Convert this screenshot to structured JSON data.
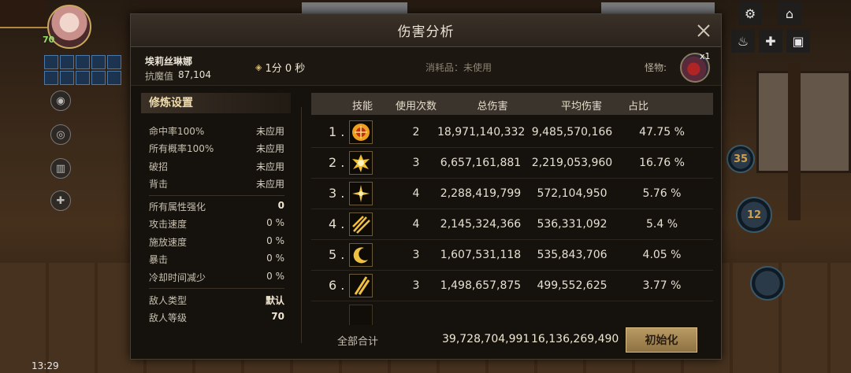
{
  "dialog": {
    "title": "伤害分析",
    "close_icon": "close-icon"
  },
  "info": {
    "character_name": "埃莉丝琳娜",
    "resist_label": "抗魔值",
    "resist_value": "87,104",
    "time": "1分 0 秒",
    "consumable_label": "消耗品：",
    "consumable_value": "未使用",
    "monster_label": "怪物:",
    "monster_count": "x1"
  },
  "settings": {
    "header": "修炼设置",
    "rows": [
      {
        "key": "命中率100%",
        "value": "未应用"
      },
      {
        "key": "所有概率100%",
        "value": "未应用"
      },
      {
        "key": "破招",
        "value": "未应用"
      },
      {
        "key": "背击",
        "value": "未应用"
      },
      {
        "key": "所有属性强化",
        "value": "0"
      },
      {
        "key": "攻击速度",
        "value": "0 %"
      },
      {
        "key": "施放速度",
        "value": "0 %"
      },
      {
        "key": "暴击",
        "value": "0 %"
      },
      {
        "key": "冷却时间减少",
        "value": "0 %"
      },
      {
        "key": "敌人类型",
        "value": "默认"
      },
      {
        "key": "敌人等级",
        "value": "70"
      }
    ]
  },
  "table": {
    "headers": {
      "skill": "技能",
      "uses": "使用次数",
      "total": "总伤害",
      "avg": "平均伤害",
      "share": "占比"
    },
    "rows": [
      {
        "rank": "1 .",
        "icon": "fire-burst-icon",
        "uses": "2",
        "total": "18,971,140,332",
        "avg": "9,485,570,166",
        "share": "47.75 %"
      },
      {
        "rank": "2 .",
        "icon": "explosion-icon",
        "uses": "3",
        "total": "6,657,161,881",
        "avg": "2,219,053,960",
        "share": "16.76 %"
      },
      {
        "rank": "3 .",
        "icon": "spark-cross-icon",
        "uses": "4",
        "total": "2,288,419,799",
        "avg": "572,104,950",
        "share": "5.76 %"
      },
      {
        "rank": "4 .",
        "icon": "claw-strike-icon",
        "uses": "4",
        "total": "2,145,324,366",
        "avg": "536,331,092",
        "share": "5.4 %"
      },
      {
        "rank": "5 .",
        "icon": "crescent-icon",
        "uses": "3",
        "total": "1,607,531,118",
        "avg": "535,843,706",
        "share": "4.05 %"
      },
      {
        "rank": "6 .",
        "icon": "slash-icon",
        "uses": "3",
        "total": "1,498,657,875",
        "avg": "499,552,625",
        "share": "3.77 %"
      }
    ],
    "total_label": "全部合计",
    "total_damage": "39,728,704,991",
    "total_avg": "16,136,269,490",
    "reset_label": "初始化"
  },
  "hud": {
    "level": "70",
    "clock": "13:29",
    "skill_cd_1": "35",
    "skill_cd_2": "12"
  }
}
